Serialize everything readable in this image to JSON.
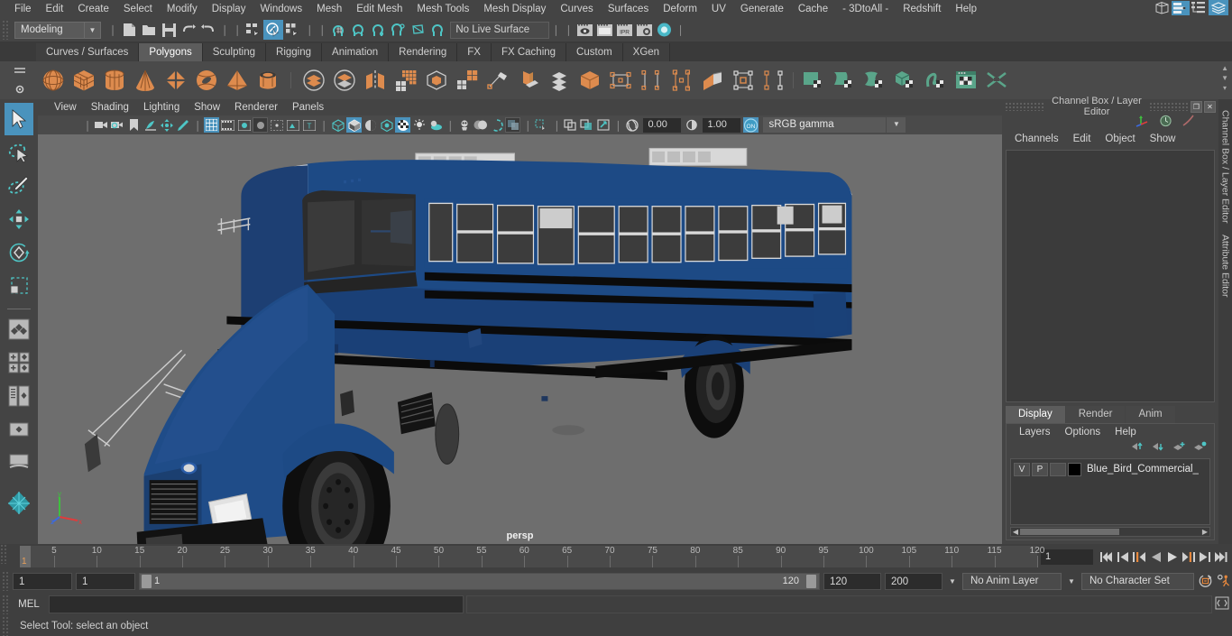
{
  "app": {
    "title": "Autodesk Maya",
    "accent": "#4a93bd",
    "orange": "#e8883c",
    "green": "#5aa58a",
    "viewport_bg": "#6e6e6e"
  },
  "menubar": {
    "items": [
      {
        "label": "File"
      },
      {
        "label": "Edit"
      },
      {
        "label": "Create"
      },
      {
        "label": "Select"
      },
      {
        "label": "Modify"
      },
      {
        "label": "Display"
      },
      {
        "label": "Windows"
      },
      {
        "label": "Mesh"
      },
      {
        "label": "Edit Mesh"
      },
      {
        "label": "Mesh Tools"
      },
      {
        "label": "Mesh Display"
      },
      {
        "label": "Curves"
      },
      {
        "label": "Surfaces"
      },
      {
        "label": "Deform"
      },
      {
        "label": "UV"
      },
      {
        "label": "Generate"
      },
      {
        "label": "Cache"
      },
      {
        "label": "- 3DtoAll -"
      },
      {
        "label": "Redshift"
      },
      {
        "label": "Help"
      }
    ],
    "right_icons": [
      "model-panel-icon",
      "attribute-editor-icon",
      "outliner-icon",
      "layers-icon"
    ]
  },
  "statusbar": {
    "mode": "Modeling",
    "live_surface": "No Live Surface",
    "file_icons": [
      "new-scene-icon",
      "open-scene-icon",
      "save-scene-icon",
      "undo-icon",
      "redo-icon"
    ],
    "select_mask_icons": [
      "select-hierarchy-icon",
      "select-object-icon",
      "select-component-icon"
    ],
    "snap_icons": [
      "snap-to-grid-icon",
      "snap-to-curve-icon",
      "snap-to-point-icon",
      "snap-to-projected-center-icon",
      "snap-to-view-plane-icon",
      "make-live-icon"
    ],
    "render_icons": [
      "render-current-frame-icon",
      "render-sequence-icon",
      "ipr-render-icon",
      "render-settings-icon",
      "hypershade-icon"
    ]
  },
  "shelf": {
    "tabs": [
      {
        "label": "Curves / Surfaces",
        "active": false
      },
      {
        "label": "Polygons",
        "active": true
      },
      {
        "label": "Sculpting",
        "active": false
      },
      {
        "label": "Rigging",
        "active": false
      },
      {
        "label": "Animation",
        "active": false
      },
      {
        "label": "Rendering",
        "active": false
      },
      {
        "label": "FX",
        "active": false
      },
      {
        "label": "FX Caching",
        "active": false
      },
      {
        "label": "Custom",
        "active": false
      },
      {
        "label": "XGen",
        "active": false
      }
    ],
    "icons": [
      "poly-sphere-icon",
      "poly-cube-icon",
      "poly-cylinder-icon",
      "poly-cone-icon",
      "poly-plane-icon",
      "poly-torus-icon",
      "poly-pyramid-icon",
      "poly-pipe-icon",
      "combine-icon",
      "separate-icon",
      "mirror-geometry-icon",
      "smooth-icon",
      "boolean-icon",
      "extrude-icon",
      "bevel-icon",
      "multi-cut-icon",
      "target-weld-icon",
      "quad-draw-icon",
      "insert-edge-loop-icon",
      "offset-edge-loop-icon",
      "bridge-icon",
      "append-to-polygon-icon",
      "wedge-face-icon",
      "sculpt-icon",
      "uv-planar-icon",
      "uv-cylindrical-icon",
      "uv-spherical-icon",
      "uv-automatic-icon",
      "uv-unfold-icon",
      "uv-editor-icon",
      "uv-cut-sew-icon"
    ]
  },
  "toolbox": {
    "tools": [
      {
        "name": "select-tool",
        "selected": true
      },
      {
        "name": "lasso-select-tool",
        "selected": false
      },
      {
        "name": "paint-select-tool",
        "selected": false
      },
      {
        "name": "move-tool",
        "selected": false
      },
      {
        "name": "rotate-tool",
        "selected": false
      },
      {
        "name": "scale-tool",
        "selected": false
      }
    ],
    "layout_buttons": [
      {
        "name": "single-perspective-layout"
      },
      {
        "name": "four-view-layout"
      },
      {
        "name": "outliner-persp-layout"
      },
      {
        "name": "persp-graph-layout"
      },
      {
        "name": "hypershade-layout"
      }
    ]
  },
  "viewport": {
    "menu": [
      {
        "label": "View"
      },
      {
        "label": "Shading"
      },
      {
        "label": "Lighting"
      },
      {
        "label": "Show"
      },
      {
        "label": "Renderer"
      },
      {
        "label": "Panels"
      }
    ],
    "camera_label": "persp",
    "exposure": "0.00",
    "gamma": "1.00",
    "color_management": "sRGB gamma",
    "toolbar_icons": [
      "select-camera-icon",
      "camera-attributes-icon",
      "bookmark-icon",
      "image-plane-icon",
      "2d-pan-zoom-icon",
      "grease-pencil-icon",
      "grid-toggle-icon",
      "film-gate-icon",
      "resolution-gate-icon",
      "gate-mask-icon",
      "field-chart-icon",
      "safe-action-icon",
      "safe-title-icon",
      "wireframe-icon",
      "smooth-shade-icon",
      "shaded-wireframe-icon",
      "use-default-material-icon",
      "textured-icon",
      "use-all-lights-icon",
      "shadows-icon",
      "screen-space-ao-icon",
      "motion-blur-icon",
      "multisample-aa-icon",
      "depth-of-field-icon",
      "isolate-select-icon",
      "xray-icon",
      "xray-joints-icon",
      "xray-active-components-icon"
    ],
    "scene_object": "Blue_Bird_Commercial_Bus",
    "axis_labels": {
      "x": "x",
      "y": "y",
      "z": "z"
    }
  },
  "channel_box": {
    "title": "Channel Box / Layer Editor",
    "menu": [
      {
        "label": "Channels"
      },
      {
        "label": "Edit"
      },
      {
        "label": "Object"
      },
      {
        "label": "Show"
      }
    ],
    "header_icons": [
      "transform-channels-icon",
      "anim-channels-icon",
      "shaping-channels-icon"
    ],
    "window_buttons": [
      "undock-icon",
      "close-icon"
    ]
  },
  "layer_editor": {
    "tabs": [
      {
        "label": "Display",
        "active": true
      },
      {
        "label": "Render",
        "active": false
      },
      {
        "label": "Anim",
        "active": false
      }
    ],
    "menu": [
      {
        "label": "Layers"
      },
      {
        "label": "Options"
      },
      {
        "label": "Help"
      }
    ],
    "buttons": [
      "move-layer-up-icon",
      "move-layer-down-icon",
      "new-layer-icon",
      "new-layer-from-selected-icon"
    ],
    "layers": [
      {
        "visible": "V",
        "playback": "P",
        "type": "",
        "color": "#000000",
        "name": "Blue_Bird_Commercial_"
      }
    ]
  },
  "vtabs": [
    {
      "label": "Channel Box / Layer Editor"
    },
    {
      "label": "Attribute Editor"
    }
  ],
  "timeslider": {
    "start": 1,
    "end": 120,
    "current_frame": "1",
    "tick_labels": [
      5,
      10,
      15,
      20,
      25,
      30,
      35,
      40,
      45,
      50,
      55,
      60,
      65,
      70,
      75,
      80,
      85,
      90,
      95,
      100,
      105,
      110,
      115,
      120
    ],
    "playback_buttons": [
      "go-to-start-icon",
      "step-back-keyframe-icon",
      "step-back-frame-icon",
      "play-backwards-icon",
      "play-forwards-icon",
      "step-forward-frame-icon",
      "step-forward-keyframe-icon",
      "go-to-end-icon"
    ]
  },
  "rangeslider": {
    "anim_start": "1",
    "range_start": "1",
    "range_start_label": "1",
    "range_end_label": "120",
    "range_end": "120",
    "anim_end": "200",
    "anim_layer": "No Anim Layer",
    "character_set": "No Character Set",
    "icons": [
      "auto-keyframe-icon",
      "animation-preferences-icon"
    ]
  },
  "commandline": {
    "language": "MEL",
    "input_value": "",
    "result_value": "",
    "script_editor_icon": "script-editor-icon"
  },
  "helpline": {
    "text": "Select Tool: select an object"
  }
}
